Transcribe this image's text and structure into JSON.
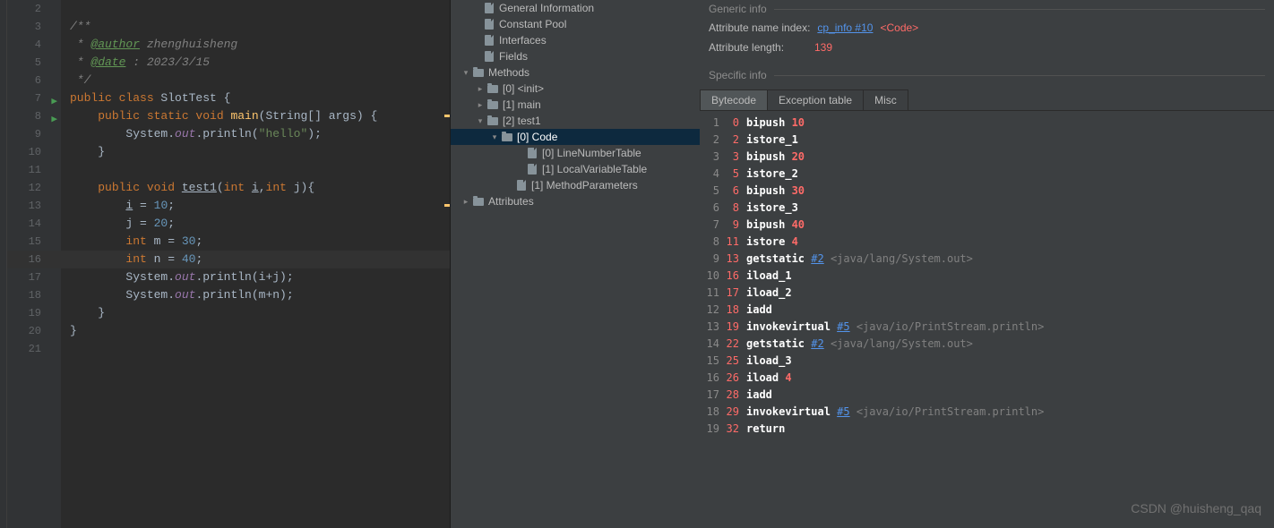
{
  "editor": {
    "lines": [
      {
        "n": 2,
        "tokens": [
          {
            "t": "",
            "c": ""
          }
        ]
      },
      {
        "n": 3,
        "tokens": [
          {
            "t": "/**",
            "c": "cmt-doc"
          }
        ]
      },
      {
        "n": 4,
        "tokens": [
          {
            "t": " * ",
            "c": "cmt-doc"
          },
          {
            "t": "@author",
            "c": "ann"
          },
          {
            "t": " zhenghuisheng",
            "c": "cmt-doc"
          }
        ]
      },
      {
        "n": 5,
        "tokens": [
          {
            "t": " * ",
            "c": "cmt-doc"
          },
          {
            "t": "@date",
            "c": "ann"
          },
          {
            "t": " : 2023/3/15",
            "c": "cmt-doc"
          }
        ]
      },
      {
        "n": 6,
        "tokens": [
          {
            "t": " */",
            "c": "cmt-doc"
          }
        ]
      },
      {
        "n": 7,
        "run": true,
        "fold": true,
        "tokens": [
          {
            "t": "public class ",
            "c": "kw"
          },
          {
            "t": "SlotTest ",
            "c": "cls"
          },
          {
            "t": "{",
            "c": ""
          }
        ]
      },
      {
        "n": 8,
        "run": true,
        "fold": true,
        "tokens": [
          {
            "t": "    ",
            "c": ""
          },
          {
            "t": "public static void ",
            "c": "kw"
          },
          {
            "t": "main",
            "c": "meth"
          },
          {
            "t": "(",
            "c": ""
          },
          {
            "t": "String",
            "c": "cls"
          },
          {
            "t": "[] ",
            "c": ""
          },
          {
            "t": "args",
            "c": ""
          },
          {
            "t": ") {",
            "c": ""
          }
        ],
        "editmark": true
      },
      {
        "n": 9,
        "tokens": [
          {
            "t": "        System.",
            "c": ""
          },
          {
            "t": "out",
            "c": "fld"
          },
          {
            "t": ".println(",
            "c": ""
          },
          {
            "t": "\"hello\"",
            "c": "str"
          },
          {
            "t": ");",
            "c": ""
          }
        ]
      },
      {
        "n": 10,
        "tokens": [
          {
            "t": "    }",
            "c": ""
          }
        ]
      },
      {
        "n": 11,
        "tokens": [
          {
            "t": "",
            "c": ""
          }
        ]
      },
      {
        "n": 12,
        "fold": true,
        "tokens": [
          {
            "t": "    ",
            "c": ""
          },
          {
            "t": "public void ",
            "c": "kw"
          },
          {
            "t": "test1",
            "c": "methu"
          },
          {
            "t": "(",
            "c": ""
          },
          {
            "t": "int ",
            "c": "kw"
          },
          {
            "t": "i",
            "c": "methu"
          },
          {
            "t": ",",
            "c": ""
          },
          {
            "t": "int ",
            "c": "kw"
          },
          {
            "t": "j",
            "c": ""
          },
          {
            "t": "){",
            "c": ""
          }
        ],
        "editmark": true
      },
      {
        "n": 13,
        "tokens": [
          {
            "t": "        ",
            "c": ""
          },
          {
            "t": "i",
            "c": "methu"
          },
          {
            "t": " = ",
            "c": ""
          },
          {
            "t": "10",
            "c": "num"
          },
          {
            "t": ";",
            "c": ""
          }
        ]
      },
      {
        "n": 14,
        "tokens": [
          {
            "t": "        j = ",
            "c": ""
          },
          {
            "t": "20",
            "c": "num"
          },
          {
            "t": ";",
            "c": ""
          }
        ]
      },
      {
        "n": 15,
        "tokens": [
          {
            "t": "        ",
            "c": ""
          },
          {
            "t": "int ",
            "c": "kw"
          },
          {
            "t": "m = ",
            "c": ""
          },
          {
            "t": "30",
            "c": "num"
          },
          {
            "t": ";",
            "c": ""
          }
        ]
      },
      {
        "n": 16,
        "hl": true,
        "tokens": [
          {
            "t": "        ",
            "c": ""
          },
          {
            "t": "int ",
            "c": "kw"
          },
          {
            "t": "n = ",
            "c": ""
          },
          {
            "t": "40",
            "c": "num"
          },
          {
            "t": ";",
            "c": ""
          }
        ]
      },
      {
        "n": 17,
        "tokens": [
          {
            "t": "        System.",
            "c": ""
          },
          {
            "t": "out",
            "c": "fld"
          },
          {
            "t": ".println(i+j);",
            "c": ""
          }
        ]
      },
      {
        "n": 18,
        "tokens": [
          {
            "t": "        System.",
            "c": ""
          },
          {
            "t": "out",
            "c": "fld"
          },
          {
            "t": ".println(m+n);",
            "c": ""
          }
        ]
      },
      {
        "n": 19,
        "fold": true,
        "tokens": [
          {
            "t": "    }",
            "c": ""
          }
        ]
      },
      {
        "n": 20,
        "fold": true,
        "tokens": [
          {
            "t": "}",
            "c": ""
          }
        ]
      },
      {
        "n": 21,
        "tokens": [
          {
            "t": "",
            "c": ""
          }
        ]
      }
    ]
  },
  "tree": [
    {
      "indent": 24,
      "arrow": "",
      "icon": "file",
      "label": "General Information"
    },
    {
      "indent": 24,
      "arrow": "",
      "icon": "file",
      "label": "Constant Pool"
    },
    {
      "indent": 24,
      "arrow": "",
      "icon": "file",
      "label": "Interfaces"
    },
    {
      "indent": 24,
      "arrow": "",
      "icon": "file",
      "label": "Fields"
    },
    {
      "indent": 12,
      "arrow": "▾",
      "icon": "folder",
      "label": "Methods"
    },
    {
      "indent": 28,
      "arrow": "▸",
      "icon": "folder",
      "label": "[0] <init>"
    },
    {
      "indent": 28,
      "arrow": "▸",
      "icon": "folder",
      "label": "[1] main"
    },
    {
      "indent": 28,
      "arrow": "▾",
      "icon": "folder",
      "label": "[2] test1"
    },
    {
      "indent": 44,
      "arrow": "▾",
      "icon": "folder",
      "label": "[0] Code",
      "selected": true
    },
    {
      "indent": 72,
      "arrow": "",
      "icon": "file",
      "label": "[0] LineNumberTable"
    },
    {
      "indent": 72,
      "arrow": "",
      "icon": "file",
      "label": "[1] LocalVariableTable"
    },
    {
      "indent": 60,
      "arrow": "",
      "icon": "file",
      "label": "[1] MethodParameters"
    },
    {
      "indent": 12,
      "arrow": "▸",
      "icon": "folder",
      "label": "Attributes"
    }
  ],
  "generic": {
    "title": "Generic info",
    "attr_name_label": "Attribute name index:",
    "attr_name_link": "cp_info #10",
    "attr_name_tag": "<Code>",
    "attr_len_label": "Attribute length:",
    "attr_len_value": "139"
  },
  "specific": {
    "title": "Specific info"
  },
  "tabs": [
    {
      "label": "Bytecode",
      "active": true
    },
    {
      "label": "Exception table"
    },
    {
      "label": "Misc"
    }
  ],
  "bytecode": [
    {
      "ln": 1,
      "off": "0",
      "op": "bipush",
      "arg": "10",
      "argc": "bc-arg-num"
    },
    {
      "ln": 2,
      "off": "2",
      "op": "istore_1"
    },
    {
      "ln": 3,
      "off": "3",
      "op": "bipush",
      "arg": "20",
      "argc": "bc-arg-num"
    },
    {
      "ln": 4,
      "off": "5",
      "op": "istore_2"
    },
    {
      "ln": 5,
      "off": "6",
      "op": "bipush",
      "arg": "30",
      "argc": "bc-arg-num"
    },
    {
      "ln": 6,
      "off": "8",
      "op": "istore_3"
    },
    {
      "ln": 7,
      "off": "9",
      "op": "bipush",
      "arg": "40",
      "argc": "bc-arg-num"
    },
    {
      "ln": 8,
      "off": "11",
      "op": "istore",
      "arg": "4",
      "argc": "bc-arg-num"
    },
    {
      "ln": 9,
      "off": "13",
      "op": "getstatic",
      "ref": "#2",
      "cmt": "<java/lang/System.out>"
    },
    {
      "ln": 10,
      "off": "16",
      "op": "iload_1"
    },
    {
      "ln": 11,
      "off": "17",
      "op": "iload_2"
    },
    {
      "ln": 12,
      "off": "18",
      "op": "iadd"
    },
    {
      "ln": 13,
      "off": "19",
      "op": "invokevirtual",
      "ref": "#5",
      "cmt": "<java/io/PrintStream.println>"
    },
    {
      "ln": 14,
      "off": "22",
      "op": "getstatic",
      "ref": "#2",
      "cmt": "<java/lang/System.out>"
    },
    {
      "ln": 15,
      "off": "25",
      "op": "iload_3"
    },
    {
      "ln": 16,
      "off": "26",
      "op": "iload",
      "arg": "4",
      "argc": "bc-arg-num"
    },
    {
      "ln": 17,
      "off": "28",
      "op": "iadd"
    },
    {
      "ln": 18,
      "off": "29",
      "op": "invokevirtual",
      "ref": "#5",
      "cmt": "<java/io/PrintStream.println>"
    },
    {
      "ln": 19,
      "off": "32",
      "op": "return"
    }
  ],
  "watermark": "CSDN @huisheng_qaq"
}
